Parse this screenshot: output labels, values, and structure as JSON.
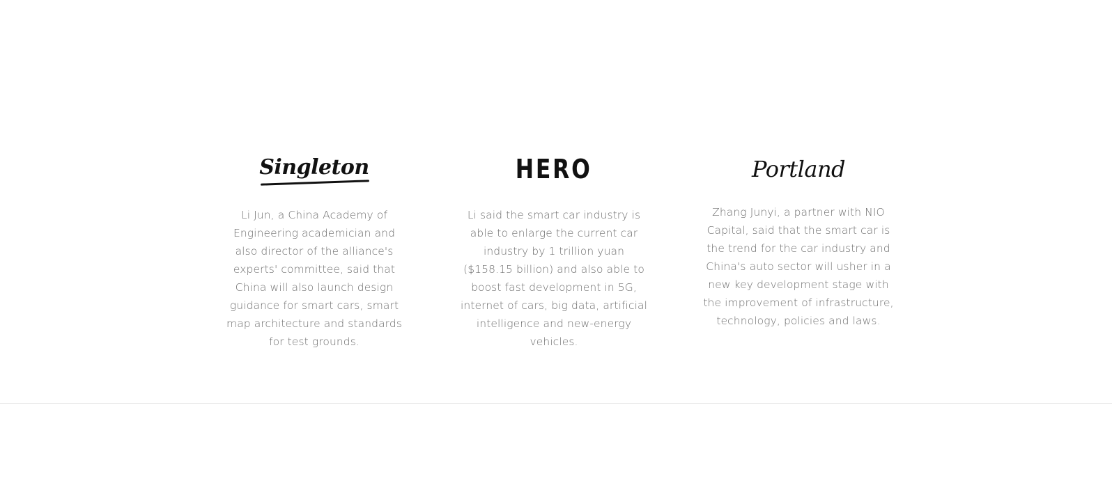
{
  "features": [
    {
      "brand": "Singleton",
      "icon": "singleton-logo-icon",
      "text": "Li Jun, a China Academy of Engineering academician and also director of the alliance's experts' committee, said that China will also launch design guidance for smart cars, smart map architecture and standards for test grounds."
    },
    {
      "brand": "HERO",
      "icon": "hero-logo-icon",
      "text": "Li said the smart car industry is able to enlarge the current car industry by 1 trillion yuan ($158.15 billion) and also able to boost fast development in 5G, internet of cars, big data, artificial intelligence and new-energy vehicles."
    },
    {
      "brand": "Portland",
      "icon": "portland-logo-icon",
      "text": "Zhang Junyi, a partner with NIO Capital, said that the smart car is the trend for the car industry and China's auto sector will usher in a new key development stage with the improvement of infrastructure, technology, policies and laws."
    }
  ],
  "colors": {
    "background": "#ffffff",
    "logo": "#111111",
    "body_text": "#6f6f6f",
    "divider": "#e6e6e6"
  }
}
